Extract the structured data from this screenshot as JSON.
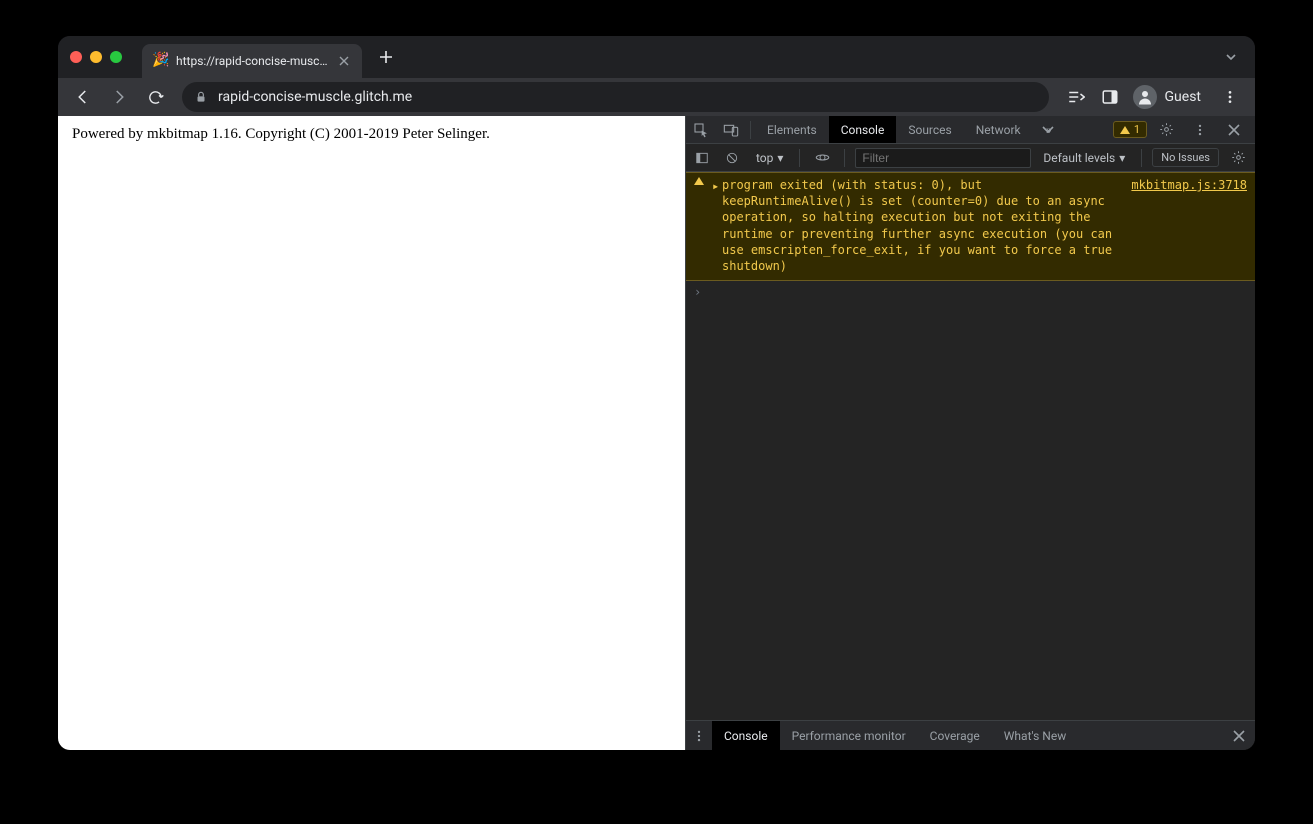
{
  "browserTab": {
    "title": "https://rapid-concise-muscle.g",
    "favicon": "🎉"
  },
  "omnibox": {
    "url": "rapid-concise-muscle.glitch.me"
  },
  "profile": {
    "label": "Guest"
  },
  "pageContent": {
    "text": "Powered by mkbitmap 1.16. Copyright (C) 2001-2019 Peter Selinger."
  },
  "devtools": {
    "tabs": {
      "elements": "Elements",
      "console": "Console",
      "sources": "Sources",
      "network": "Network"
    },
    "warnBadge": "1",
    "subbar": {
      "context": "top",
      "filterPlaceholder": "Filter",
      "levels": "Default levels",
      "issues": "No Issues"
    },
    "log": {
      "message": "program exited (with status: 0), but keepRuntimeAlive() is set (counter=0) due to an async operation, so halting execution but not exiting the runtime or preventing further async execution (you can use emscripten_force_exit, if you want to force a true shutdown)",
      "source": "mkbitmap.js:3718"
    },
    "drawer": {
      "console": "Console",
      "perf": "Performance monitor",
      "coverage": "Coverage",
      "whatsnew": "What's New"
    }
  }
}
